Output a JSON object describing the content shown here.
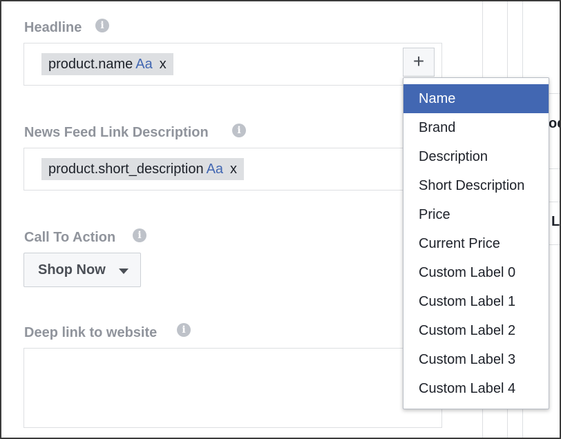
{
  "headline": {
    "label": "Headline",
    "token_text": "product.name",
    "token_format": "Aa",
    "token_remove": "x",
    "add_button": "+"
  },
  "link_description": {
    "label": "News Feed Link Description",
    "token_text": "product.short_description",
    "token_format": "Aa",
    "token_remove": "x"
  },
  "call_to_action": {
    "label": "Call To Action",
    "selected": "Shop Now"
  },
  "deep_link": {
    "label": "Deep link to website",
    "value": ""
  },
  "info_icon_glyph": "i",
  "right_pane": {
    "clipped_text_1": "od",
    "clipped_text_2": "L"
  },
  "dropdown": {
    "items": [
      "Name",
      "Brand",
      "Description",
      "Short Description",
      "Price",
      "Current Price",
      "Custom Label 0",
      "Custom Label 1",
      "Custom Label 2",
      "Custom Label 3",
      "Custom Label 4"
    ],
    "highlighted": "Name"
  },
  "colors": {
    "accent": "#4267b2",
    "label_gray": "#90949c",
    "border": "#dddfe2"
  },
  "icons": [
    "info-icon",
    "plus-icon",
    "caret-down-icon"
  ]
}
